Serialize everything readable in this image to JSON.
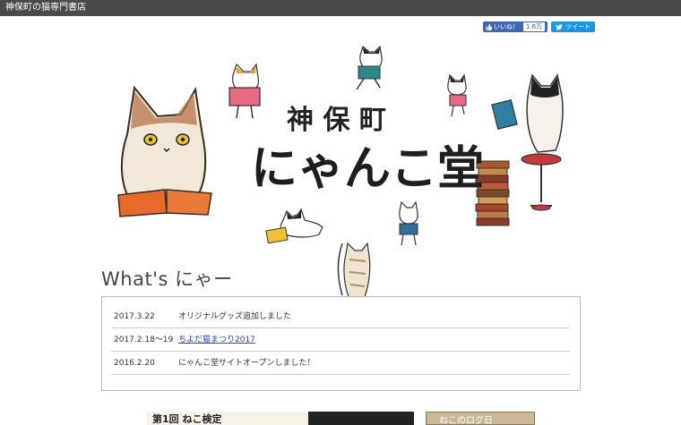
{
  "header": {
    "site_title": "神保町の猫専門書店"
  },
  "social": {
    "like_label": "いいね！",
    "like_count": "1.6万",
    "tweet_label": "ツイート"
  },
  "hero": {
    "logo_line1": "神 保 町",
    "logo_line2": "にゃんこ堂"
  },
  "news": {
    "heading": "What's にゃー",
    "items": [
      {
        "date": "2017.3.22",
        "text": "オリジナルグッズ追加しました"
      },
      {
        "date": "2017.2.18〜19",
        "text": "ちよだ猫まつり2017"
      },
      {
        "date": "2016.2.20",
        "text": "にゃんこ堂サイトオープンしました！"
      }
    ]
  },
  "banners": {
    "banner1_text": "第1回 ねこ検定",
    "banner2_text": "ねこのログ日"
  },
  "colors": {
    "topbar": "#4a4a4a",
    "facebook": "#4267b2",
    "twitter": "#1b95e0",
    "link": "#2b46b6"
  }
}
